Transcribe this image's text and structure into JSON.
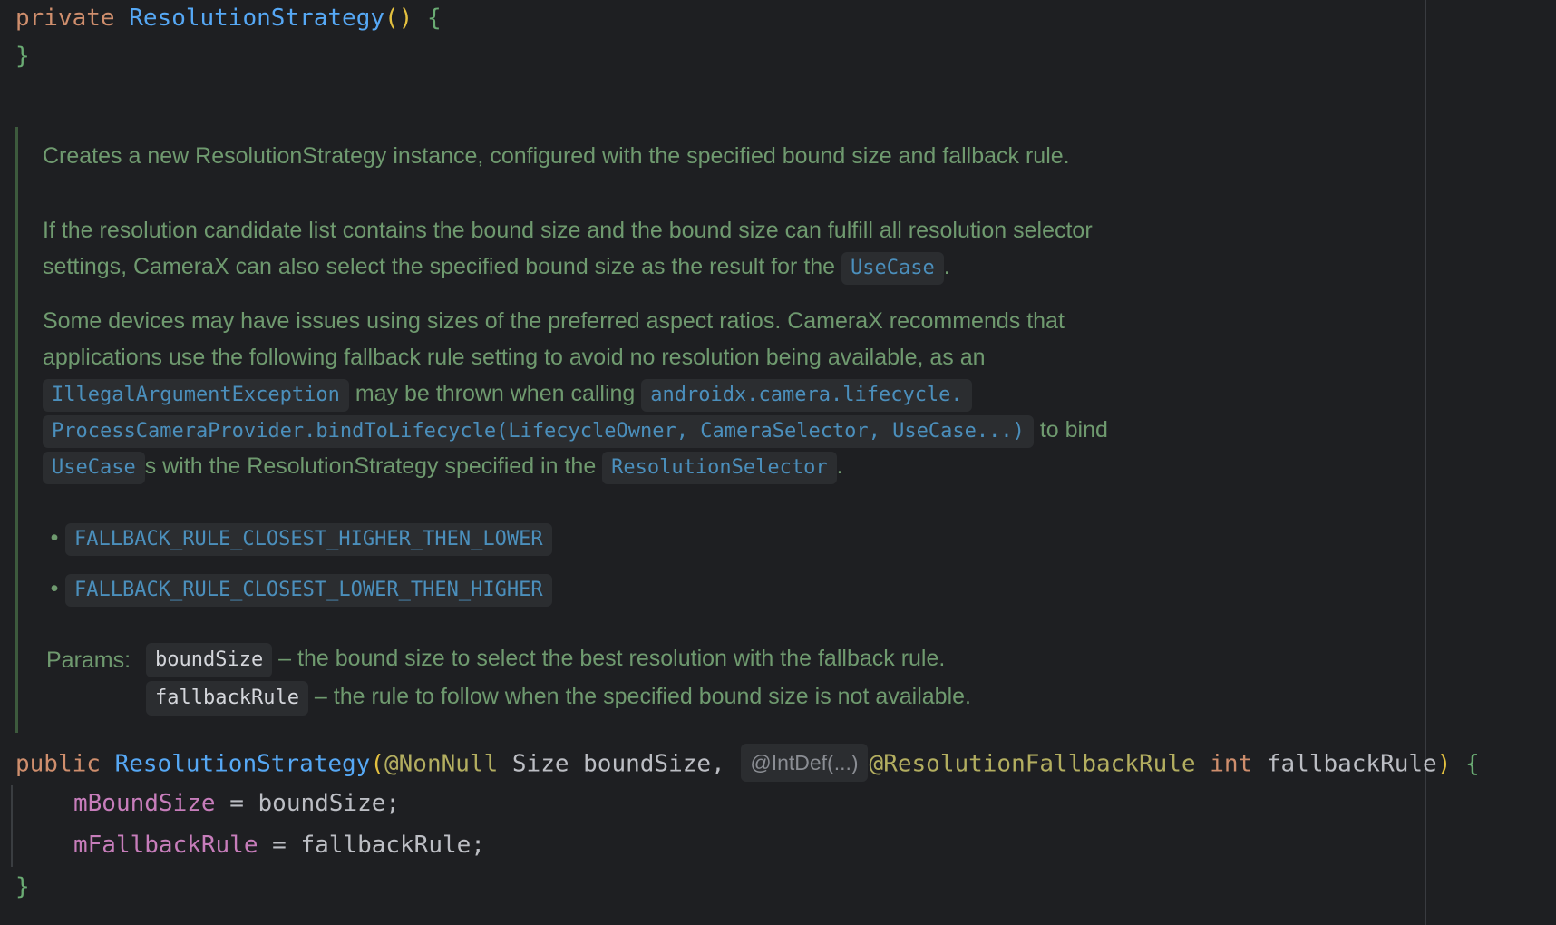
{
  "code": {
    "line1": {
      "kw": "private",
      "fn": "ResolutionStrategy",
      "parens": "()",
      "brace_open": "{"
    },
    "line2": {
      "brace_close": "}"
    },
    "sig": {
      "kw": "public",
      "fn": "ResolutionStrategy",
      "paren_open": "(",
      "ann1": "@NonNull",
      "part1": " Size boundSize, ",
      "inlay": "@IntDef(...)",
      "ann2": "@ResolutionFallbackRule",
      "kw_int": "int",
      "part2": " fallbackRule",
      "paren_close": ")",
      "brace_open": "{"
    },
    "body1": {
      "field": "mBoundSize",
      "rest": " = boundSize;"
    },
    "body2": {
      "field": "mFallbackRule",
      "rest": " = fallbackRule;"
    },
    "last": {
      "brace_close": "}"
    }
  },
  "doc": {
    "p1": "Creates a new ResolutionStrategy instance, configured with the specified bound size and fallback rule.",
    "p2_a": "If the resolution candidate list contains the bound size and the bound size can fulfill all resolution selector settings, CameraX can also select the specified bound size as the result for the",
    "p2_chip": "UseCase",
    "p2_b": ".",
    "p3_a": "Some devices may have issues using sizes of the preferred aspect ratios. CameraX recommends that applications use the following fallback rule setting to avoid no resolution being available, as an",
    "p3_chip1": "IllegalArgumentException",
    "p3_b": "may be thrown when calling",
    "p3_chip2": "androidx.camera.lifecycle.",
    "p3_chip3": "ProcessCameraProvider.bindToLifecycle(LifecycleOwner, CameraSelector, UseCase...)",
    "p3_c": "to bind",
    "p3_chip4": "UseCase",
    "p3_d": "s with the ResolutionStrategy specified in the",
    "p3_chip5": "ResolutionSelector",
    "p3_e": ".",
    "bullets": [
      "FALLBACK_RULE_CLOSEST_HIGHER_THEN_LOWER",
      "FALLBACK_RULE_CLOSEST_LOWER_THEN_HIGHER"
    ],
    "params_label": "Params:",
    "params": [
      {
        "name": "boundSize",
        "desc": "– the bound size to select the best resolution with the fallback rule."
      },
      {
        "name": "fallbackRule",
        "desc": "– the rule to follow when the specified bound size is not available."
      }
    ]
  },
  "colors": {
    "background": "#1e1f22",
    "keyword": "#cf8e6d",
    "function": "#56a8f5",
    "doc_text": "#6f9a6f",
    "doc_link": "#4b8fbc",
    "field": "#c77dbb",
    "annotation": "#b3ae60"
  }
}
